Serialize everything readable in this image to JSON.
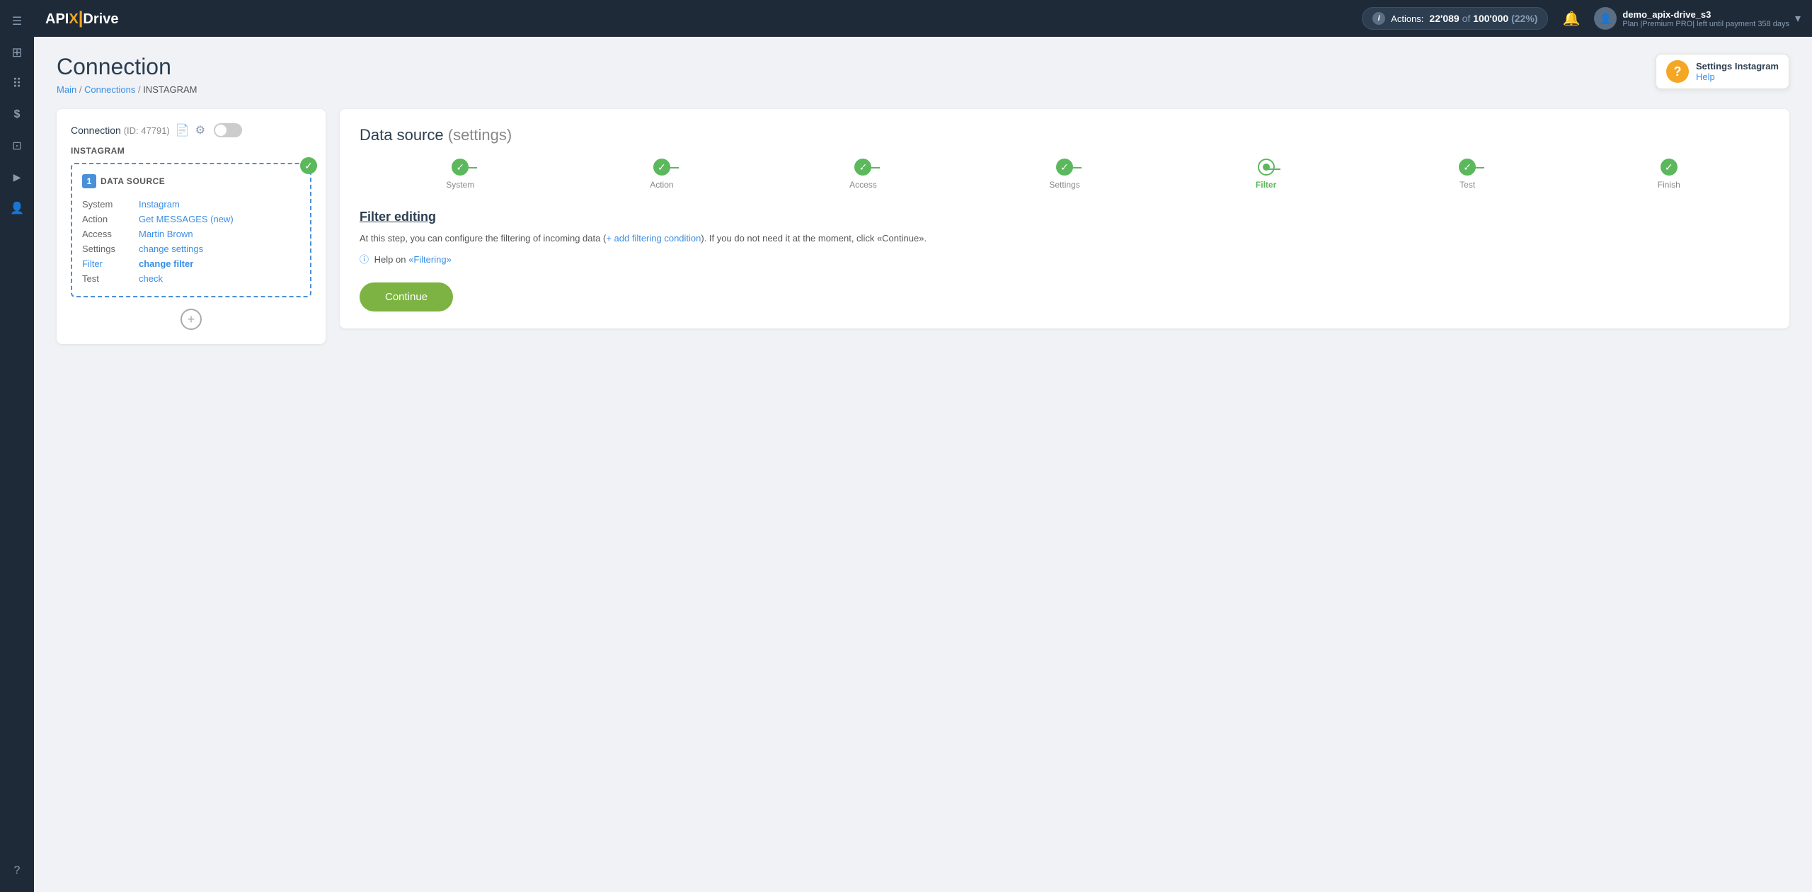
{
  "topnav": {
    "logo": "APIXDrive",
    "actions_label": "Actions:",
    "actions_count": "22'089",
    "actions_of": "of",
    "actions_total": "100'000",
    "actions_percent": "(22%)",
    "user_name": "demo_apix-drive_s3",
    "user_plan": "Plan |Premium PRO| left until payment 358 days"
  },
  "breadcrumb": {
    "main": "Main",
    "connections": "Connections",
    "current": "INSTAGRAM"
  },
  "page_title": "Connection",
  "help": {
    "title": "Settings Instagram",
    "link": "Help"
  },
  "left_panel": {
    "conn_label": "Connection",
    "conn_id": "(ID: 47791)",
    "system_name": "INSTAGRAM",
    "datasource_label": "DATA SOURCE",
    "datasource_number": "1",
    "fields": {
      "system_label": "System",
      "system_value": "Instagram",
      "action_label": "Action",
      "action_value": "Get MESSAGES (new)",
      "access_label": "Access",
      "access_value": "Martin Brown",
      "settings_label": "Settings",
      "settings_value": "change settings",
      "filter_label": "Filter",
      "filter_value": "change filter",
      "test_label": "Test",
      "test_value": "check"
    }
  },
  "right_panel": {
    "title": "Data source",
    "title_paren": "(settings)",
    "steps": [
      {
        "label": "System",
        "state": "done"
      },
      {
        "label": "Action",
        "state": "done"
      },
      {
        "label": "Access",
        "state": "done"
      },
      {
        "label": "Settings",
        "state": "done"
      },
      {
        "label": "Filter",
        "state": "active"
      },
      {
        "label": "Test",
        "state": "done"
      },
      {
        "label": "Finish",
        "state": "done"
      }
    ],
    "filter_editing_title": "Filter editing",
    "filter_desc_pre": "At this step, you can configure the filtering of incoming data (",
    "filter_add_link": "+ add filtering condition",
    "filter_desc_post": "). If you do not need it at the moment, click «Continue».",
    "filter_help_icon": "?",
    "filter_help_pre": "Help",
    "filter_help_on": "on",
    "filter_help_link": "«Filtering»",
    "continue_label": "Continue"
  },
  "sidebar": {
    "items": [
      {
        "icon": "⊞",
        "name": "dashboard"
      },
      {
        "icon": "⠿",
        "name": "connections"
      },
      {
        "icon": "$",
        "name": "billing"
      },
      {
        "icon": "⊡",
        "name": "tools"
      },
      {
        "icon": "▶",
        "name": "media"
      },
      {
        "icon": "👤",
        "name": "profile"
      },
      {
        "icon": "?",
        "name": "help"
      }
    ]
  }
}
